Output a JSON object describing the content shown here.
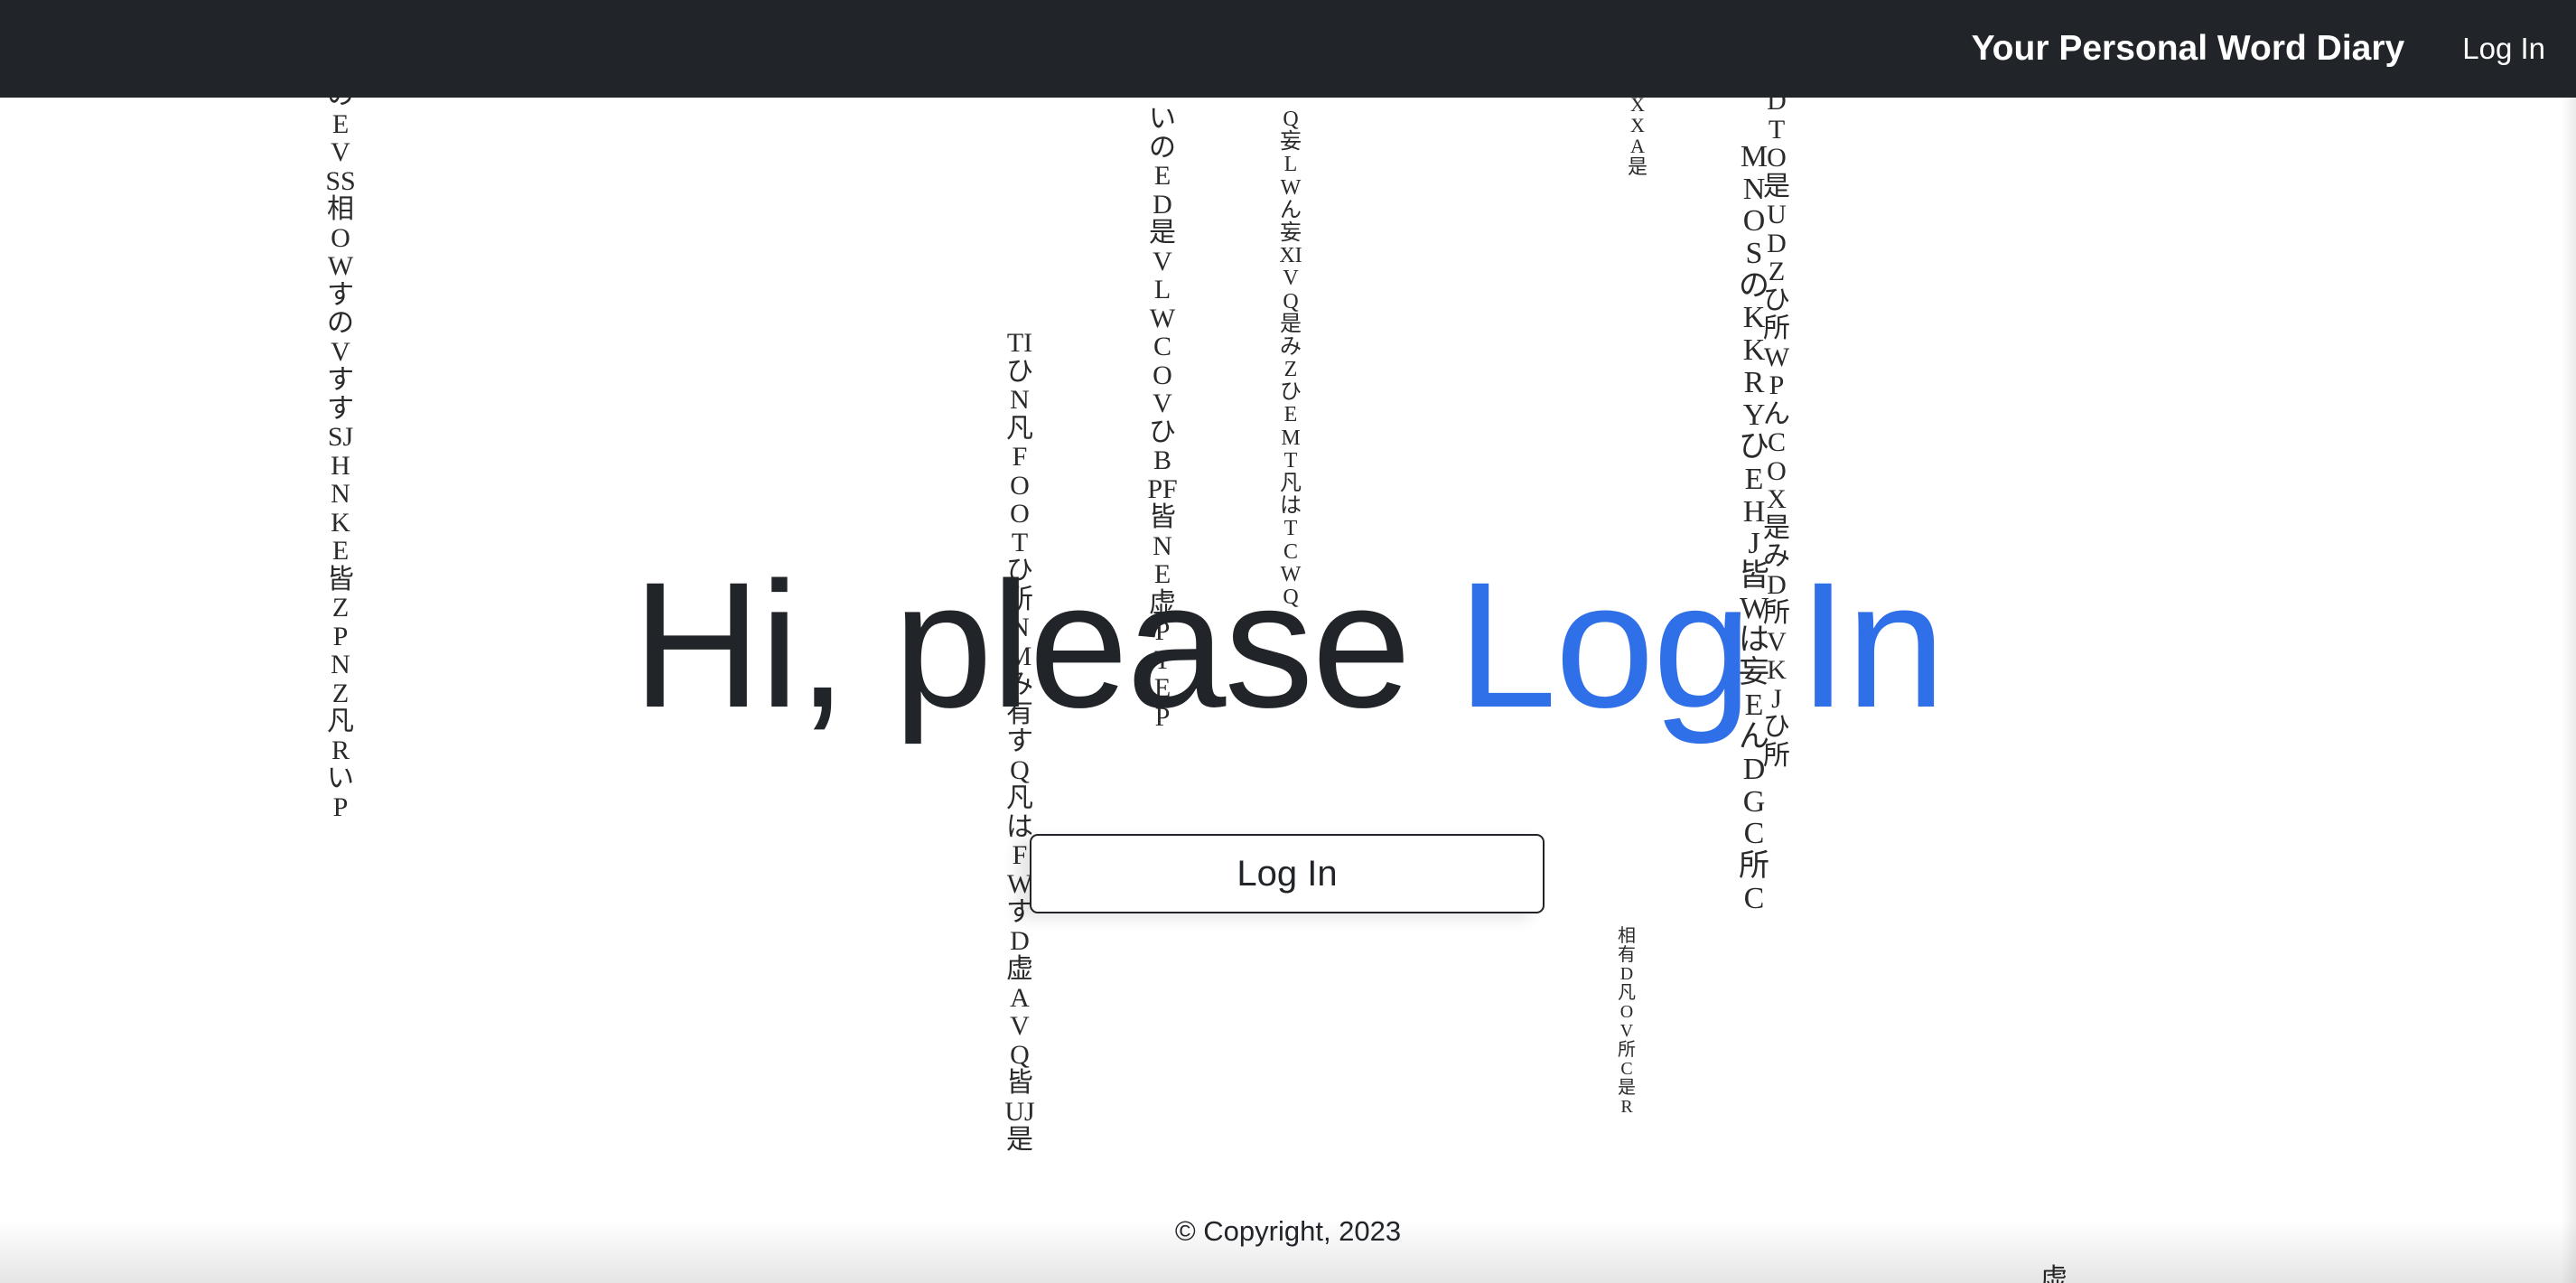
{
  "navbar": {
    "brand": "Your Personal Word Diary",
    "login_link": "Log In"
  },
  "hero": {
    "prefix": "Hi, please ",
    "accent": "Log In",
    "accent_color": "#2f6fe8"
  },
  "login_button": {
    "label": "Log In"
  },
  "footer": {
    "copyright": "© Copyright, 2023"
  },
  "rain_columns": [
    "のEVSS相OWすのVすすSJHNKE皆ZPNZ凡RいP",
    "TIひN凡FOOTひ所NMみ有すQ凡はFWすD虚AVQ皆UJ是",
    "いのED是VLWCOVひBPF皆NE虚PTEP",
    "Q妄LWん妄XIVQ是みZひEMT凡はTCWQ",
    "XXA是",
    "相有D凡OV所C是R",
    "MNOSのKKRYひEHJ皆Wは妄EんDGC所C",
    "DTO是UDZひ所WPんCOX是みD所VKJひ所",
    "虚"
  ]
}
